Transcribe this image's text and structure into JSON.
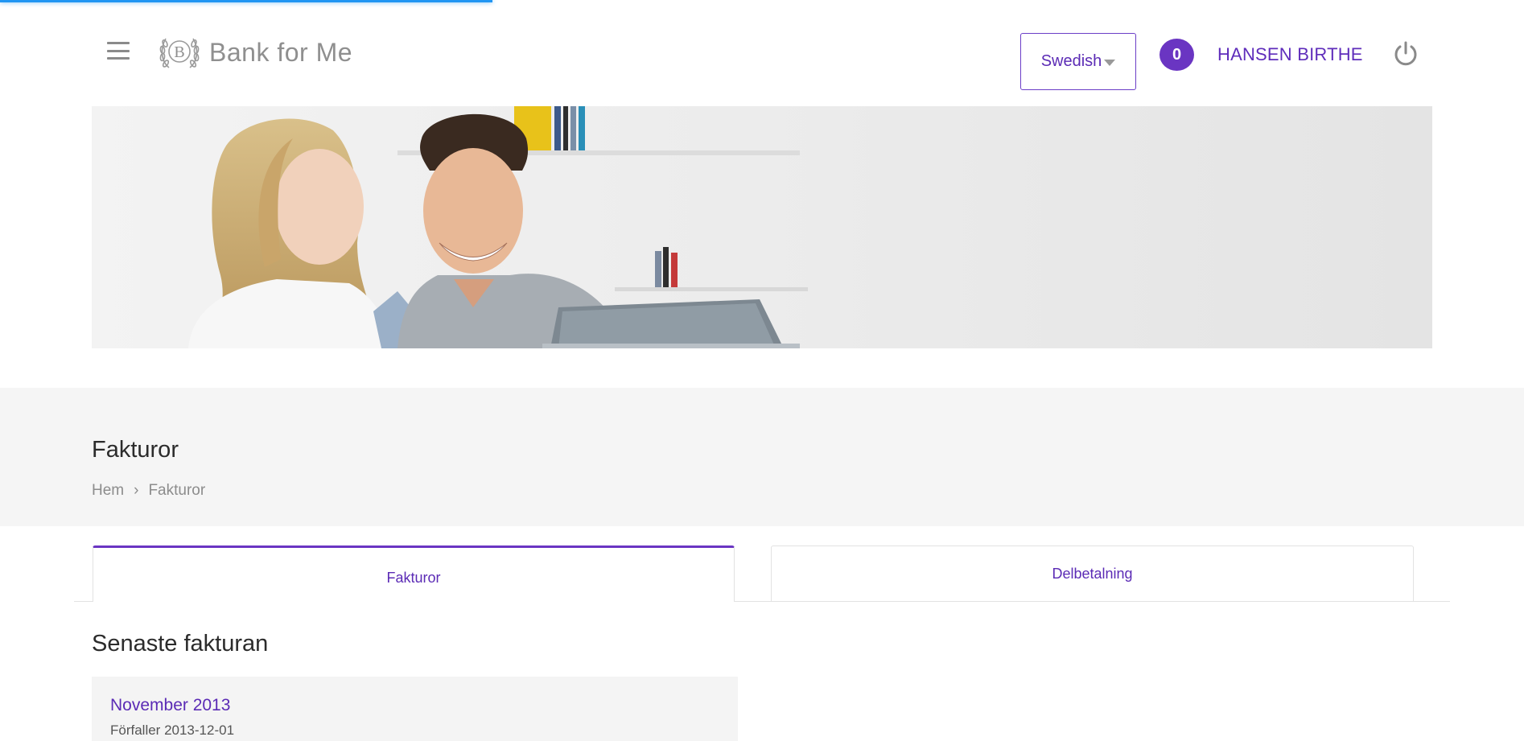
{
  "header": {
    "brand_name": "Bank for Me",
    "logo_letter": "B",
    "language": "Swedish",
    "notification_count": "0",
    "user_name": "HANSEN BIRTHE"
  },
  "page": {
    "title": "Fakturor",
    "breadcrumb": [
      "Hem",
      "Fakturor"
    ]
  },
  "tabs": [
    {
      "label": "Fakturor",
      "active": true
    },
    {
      "label": "Delbetalning",
      "active": false
    }
  ],
  "latest_invoice": {
    "section_title": "Senaste fakturan",
    "month": "November 2013",
    "due_text": "Förfaller 2013-12-01"
  },
  "colors": {
    "accent": "#6a35c2",
    "progress": "#2196f3",
    "band": "#f5f5f5"
  }
}
